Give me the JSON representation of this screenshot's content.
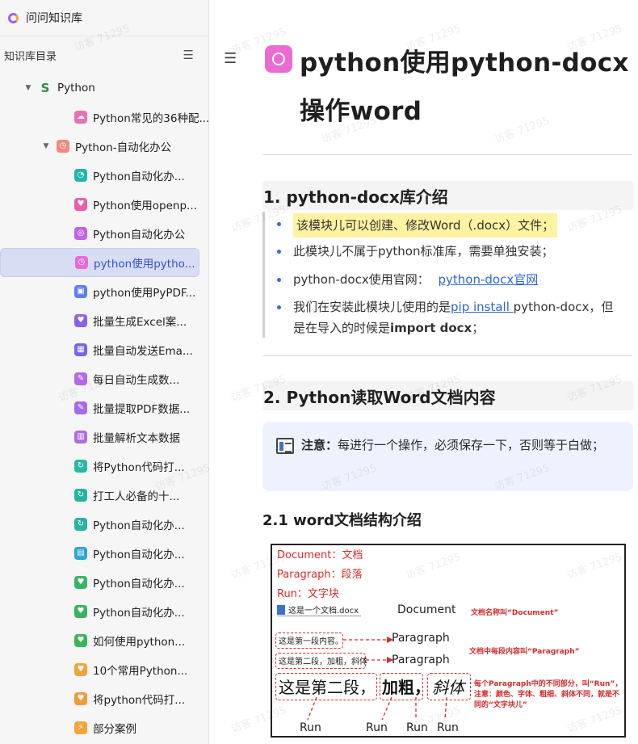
{
  "sidebar": {
    "brand": "问问知识库",
    "toc_title": "知识库目录",
    "toc_icon": "list-toggle-icon",
    "items": [
      {
        "label": "Python",
        "icon": "snake-icon",
        "color": "#2a8f3a",
        "level": 1,
        "expanded": true
      },
      {
        "label": "Python常见的36种配...",
        "icon": "cloud-icon",
        "color": "#ec6fb0",
        "level": 3
      },
      {
        "label": "Python-自动化办公",
        "icon": "clock-icon",
        "color": "#ee8a7c",
        "level": 2,
        "expanded": true
      },
      {
        "label": "Python自动化办...",
        "icon": "gauge-icon",
        "color": "#21b8a8",
        "level": 3
      },
      {
        "label": "Python使用openp...",
        "icon": "heart-icon",
        "color": "#ea5fa8",
        "level": 3
      },
      {
        "label": "Python自动化办公",
        "icon": "target-icon",
        "color": "#c260e8",
        "level": 3
      },
      {
        "label": "python使用pytho...",
        "icon": "clock-icon",
        "color": "#e96bd3",
        "level": 3,
        "active": true
      },
      {
        "label": "python使用PyPDF...",
        "icon": "gamepad-icon",
        "color": "#5b7ff0",
        "level": 3
      },
      {
        "label": "批量生成Excel案...",
        "icon": "heart-icon",
        "color": "#8b61ec",
        "level": 3
      },
      {
        "label": "批量自动发送Ema...",
        "icon": "grid-icon",
        "color": "#7b64ea",
        "level": 3
      },
      {
        "label": "每日自动生成数...",
        "icon": "note-icon",
        "color": "#b56ae6",
        "level": 3
      },
      {
        "label": "批量提取PDF数据...",
        "icon": "note-icon",
        "color": "#a669ea",
        "level": 3
      },
      {
        "label": "批量解析文本数据",
        "icon": "chart-icon",
        "color": "#b06ce0",
        "level": 3
      },
      {
        "label": "将Python代码打...",
        "icon": "refresh-icon",
        "color": "#28b9a4",
        "level": 3
      },
      {
        "label": "打工人必备的十...",
        "icon": "refresh-icon",
        "color": "#26b4a0",
        "level": 3
      },
      {
        "label": "Python自动化办...",
        "icon": "refresh-icon",
        "color": "#2bb3a1",
        "level": 3
      },
      {
        "label": "Python自动化办...",
        "icon": "window-icon",
        "color": "#2aa7d3",
        "level": 3
      },
      {
        "label": "Python自动化办...",
        "icon": "heart-icon",
        "color": "#36b665",
        "level": 3
      },
      {
        "label": "Python自动化办...",
        "icon": "heart-icon",
        "color": "#38b35f",
        "level": 3
      },
      {
        "label": "如何使用python...",
        "icon": "heart-icon",
        "color": "#3ab55a",
        "level": 3
      },
      {
        "label": "10个常用Python...",
        "icon": "heart-icon",
        "color": "#f2a43a",
        "level": 3
      },
      {
        "label": "将python代码打...",
        "icon": "heart-icon",
        "color": "#f39a38",
        "level": 3
      },
      {
        "label": "部分案例",
        "icon": "bolt-icon",
        "color": "#f2a53a",
        "level": 3
      }
    ]
  },
  "main": {
    "title": "python使用python-docx操作word",
    "title_icon": "clock-icon",
    "section1": {
      "heading": "1. python-docx库介绍",
      "bullets": {
        "b1": "该模块儿可以创建、修改Word（.docx）文件；",
        "b2": "此模块儿不属于python标准库，需要单独安装；",
        "b3_prefix": "python-docx使用官网：",
        "b3_link": "python-docx官网",
        "b4_a": "我们在安装此模块儿使用的是",
        "b4_link": "pip install ",
        "b4_b": "python-docx，但",
        "b4_c": "是在导入的时候是",
        "b4_bold": "import docx",
        "b4_d": "；"
      }
    },
    "section2": {
      "heading": "2. Python读取Word文档内容",
      "note_bold": "注意：",
      "note_text": "每进行一个操作，必须保存一下，否则等于白做；"
    },
    "section21": {
      "heading": "2.1 word文档结构介绍"
    },
    "figure": {
      "line1": "Document：文档",
      "line2": "Paragraph：段落",
      "line3": "Run：文字块",
      "file": "这是一个文档.docx",
      "document": "Document",
      "doc_note": "文档名称叫“Document”",
      "para1_text": "这是第一段内容。",
      "para2_text": "这是第二段，加粗，斜体",
      "paragraph": "Paragraph",
      "para_note": "文档中每段内容叫“Paragraph”",
      "run_note_1": "每个Paragraph中的不同部分，叫“Run”，",
      "run_note_2": "注意：颜色、字体、粗细、斜体不同，就是不",
      "run_note_3": "同的“文字块儿”",
      "big1": "这是第二段，",
      "big2": "加粗，",
      "big3": "斜体",
      "run": "Run"
    }
  },
  "watermark": "访客 71295"
}
